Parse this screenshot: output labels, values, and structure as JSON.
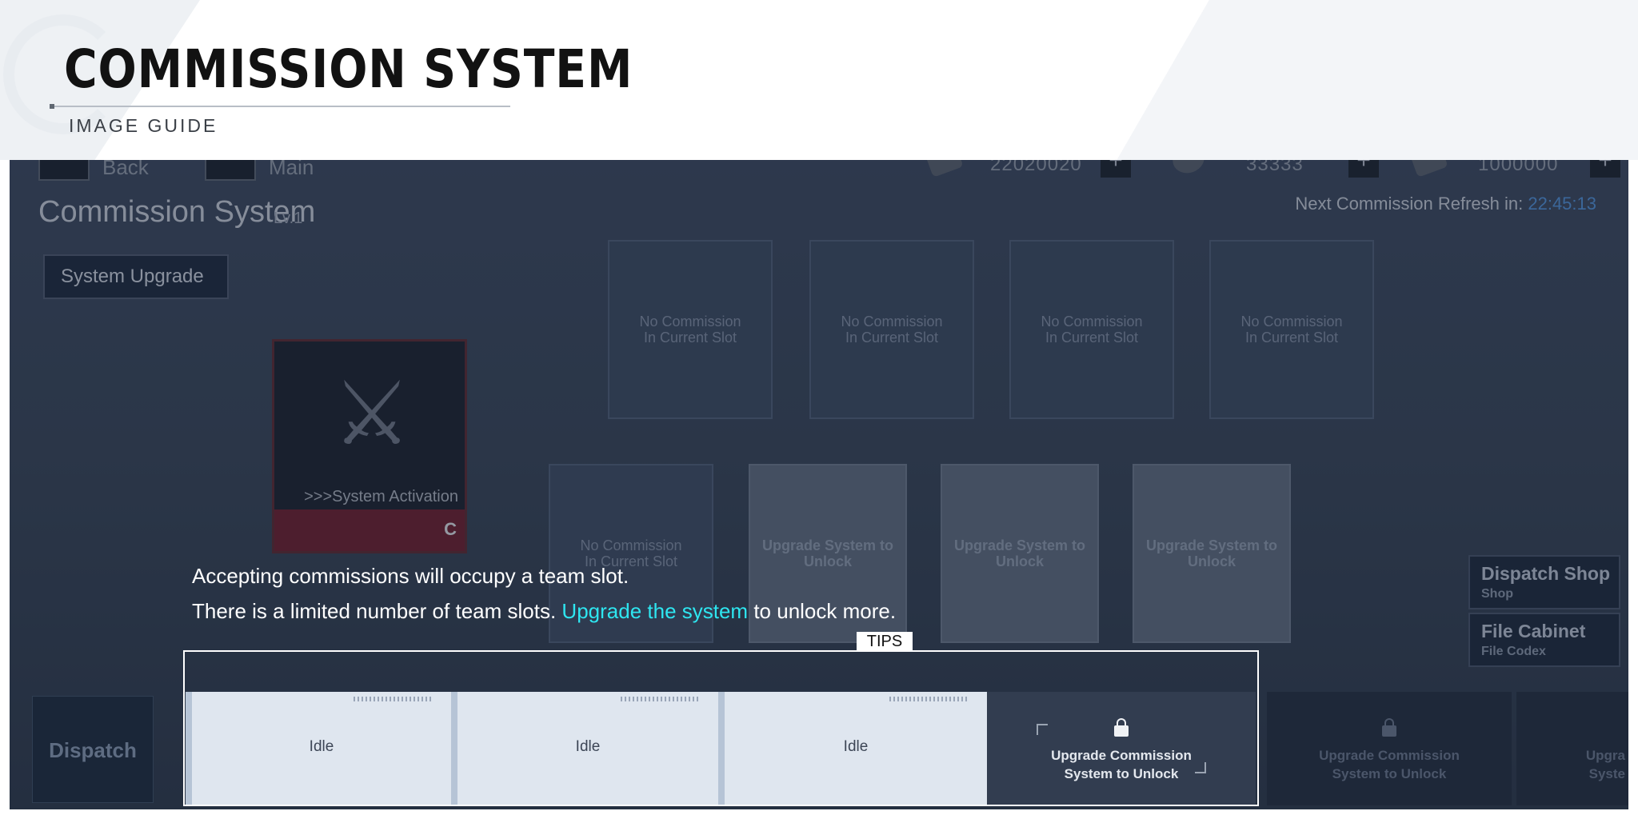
{
  "header": {
    "title": "COMMISSION SYSTEM",
    "subtitle": "IMAGE GUIDE"
  },
  "topbar": {
    "back_label": "Back",
    "main_label": "Main",
    "resources": [
      "22020020",
      "33333",
      "1000000"
    ]
  },
  "system": {
    "title": "Commission System",
    "level": "Lv.1",
    "upgrade_button": "System Upgrade",
    "refresh_label": "Next Commission Refresh in:",
    "refresh_timer": "22:45:13"
  },
  "card": {
    "text": ">>>System Activation",
    "rank": "C"
  },
  "slots": {
    "empty_label": "No Commission\nIn Current Slot",
    "upgrade_label": "Upgrade System to\nUnlock"
  },
  "side_buttons": [
    {
      "label": "Dispatch Shop",
      "sub": "Shop"
    },
    {
      "label": "File Cabinet",
      "sub": "File Codex"
    }
  ],
  "tip": {
    "line1": "Accepting commissions will occupy a team slot.",
    "line2_before": "There is a limited number of team slots.",
    "line2_highlight": "Upgrade the system",
    "line2_after": "to unlock more.",
    "tag": "TIPS"
  },
  "bottom": {
    "dispatch_label": "Dispatch",
    "team_slots": [
      "Idle",
      "Idle",
      "Idle"
    ],
    "locked_label": "Upgrade Commission\nSystem to Unlock",
    "locked_partial": "Upgra\nSyste"
  }
}
